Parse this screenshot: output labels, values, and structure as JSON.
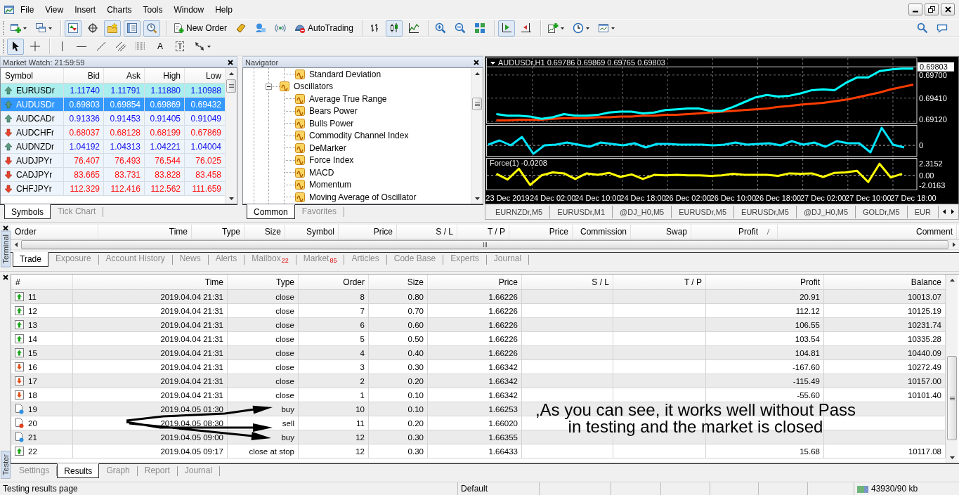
{
  "menu": {
    "items": [
      "File",
      "View",
      "Insert",
      "Charts",
      "Tools",
      "Window",
      "Help"
    ]
  },
  "toolbars": [
    {
      "groups": [
        [
          {
            "pressed": false
          },
          {
            "pressed": false
          }
        ],
        [
          {
            "pressed": true
          },
          {
            "pressed": false
          },
          {
            "pressed": true
          },
          {
            "pressed": true
          },
          {
            "pressed": true
          }
        ],
        [
          {
            "label": "New Order",
            "pressed": false
          },
          {
            "pressed": false
          },
          {
            "pressed": false
          },
          {
            "pressed": false
          },
          {
            "label": "AutoTrading",
            "pressed": false
          }
        ],
        [
          {
            "pressed": false
          },
          {
            "pressed": true
          },
          {
            "pressed": false
          }
        ],
        [
          {
            "pressed": false
          },
          {
            "pressed": false
          },
          {
            "pressed": false
          }
        ],
        [
          {
            "pressed": true
          },
          {
            "pressed": false
          }
        ],
        [
          {
            "pressed": false
          },
          {
            "pressed": false
          },
          {
            "pressed": false
          }
        ]
      ]
    },
    {
      "groups": [
        [
          {
            "pressed": true
          },
          {
            "pressed": false
          }
        ],
        [
          {
            "pressed": false
          },
          {
            "pressed": false
          },
          {
            "pressed": false
          },
          {
            "pressed": false
          },
          {
            "pressed": false
          },
          {
            "label": "A",
            "pressed": false
          },
          {
            "label": "T",
            "pressed": false
          },
          {
            "pressed": false
          }
        ]
      ]
    }
  ],
  "market_watch": {
    "title": "Market Watch: 21:59:59",
    "columns": [
      "Symbol",
      "Bid",
      "Ask",
      "High",
      "Low"
    ],
    "rows": [
      {
        "symbol": "EURUSDr",
        "bid": "1.11740",
        "ask": "1.11791",
        "high": "1.11880",
        "low": "1.10988",
        "rising": true,
        "highlighted": true,
        "selected": false
      },
      {
        "symbol": "AUDUSDr",
        "bid": "0.69803",
        "ask": "0.69854",
        "high": "0.69869",
        "low": "0.69432",
        "rising": true,
        "highlighted": false,
        "selected": true
      },
      {
        "symbol": "AUDCADr",
        "bid": "0.91336",
        "ask": "0.91453",
        "high": "0.91405",
        "low": "0.91049",
        "rising": true,
        "highlighted": false,
        "selected": false
      },
      {
        "symbol": "AUDCHFr",
        "bid": "0.68037",
        "ask": "0.68128",
        "high": "0.68199",
        "low": "0.67869",
        "rising": false,
        "highlighted": false,
        "selected": false
      },
      {
        "symbol": "AUDNZDr",
        "bid": "1.04192",
        "ask": "1.04313",
        "high": "1.04221",
        "low": "1.04004",
        "rising": true,
        "highlighted": false,
        "selected": false
      },
      {
        "symbol": "AUDJPYr",
        "bid": "76.407",
        "ask": "76.493",
        "high": "76.544",
        "low": "76.025",
        "rising": false,
        "highlighted": false,
        "selected": false
      },
      {
        "symbol": "CADJPYr",
        "bid": "83.665",
        "ask": "83.731",
        "high": "83.828",
        "low": "83.458",
        "rising": false,
        "highlighted": false,
        "selected": false
      },
      {
        "symbol": "CHFJPYr",
        "bid": "112.329",
        "ask": "112.416",
        "high": "112.562",
        "low": "111.659",
        "rising": false,
        "highlighted": false,
        "selected": false
      }
    ],
    "tabs": [
      {
        "label": "Symbols",
        "selected": true
      },
      {
        "label": "Tick Chart",
        "selected": false
      }
    ]
  },
  "navigator": {
    "title": "Navigator",
    "tree": [
      {
        "children": [
          {
            "label": "Standard Deviation"
          }
        ]
      },
      {
        "label": "Oscillators",
        "expanded": true,
        "children": [
          {
            "label": "Average True Range"
          },
          {
            "label": "Bears Power"
          },
          {
            "label": "Bulls Power"
          },
          {
            "label": "Commodity Channel Index"
          },
          {
            "label": "DeMarker"
          },
          {
            "label": "Force Index"
          },
          {
            "label": "MACD"
          },
          {
            "label": "Momentum"
          },
          {
            "label": "Moving Average of Oscillator"
          }
        ]
      }
    ],
    "tabs": [
      {
        "label": "Common",
        "selected": true
      },
      {
        "label": "Favorites",
        "selected": false
      }
    ]
  },
  "chart": {
    "chart_data": [
      {
        "type": "line",
        "title": "AUDUSDr,H1 0.69786 0.69869 0.69765 0.69803",
        "categories": [
          null,
          null,
          null,
          null,
          null,
          null,
          null,
          null,
          null,
          null,
          null,
          null,
          null,
          null,
          null,
          null,
          null,
          null,
          null,
          null,
          null,
          null,
          null,
          null,
          null,
          null,
          null,
          null,
          null,
          null,
          null,
          null,
          null,
          null,
          null,
          null,
          null,
          null
        ],
        "tick_labels": "y",
        "ylim": [
          0.691,
          0.6991
        ],
        "yticks": [
          {
            "value": 0.697,
            "label": "0.69700"
          },
          {
            "value": 0.6941,
            "label": "0.69410"
          },
          {
            "value": 0.6912,
            "label": "0.69120"
          }
        ],
        "grid": true,
        "ref_lines": [
          {
            "axis": "y",
            "value": 0.69803,
            "label": "0.69803",
            "color": "#c0c0c0"
          }
        ],
        "series": [
          {
            "color": "#00ffff",
            "values": [
              0.6921,
              0.6919,
              0.6919,
              0.6918,
              0.6915,
              0.6917,
              0.6921,
              0.6919,
              0.6919,
              0.692,
              0.6923,
              0.6924,
              0.6924,
              0.6922,
              0.6923,
              0.6926,
              0.6927,
              0.6928,
              0.6928,
              0.6925,
              0.6925,
              0.693,
              0.6936,
              0.6942,
              0.6945,
              0.6943,
              0.6944,
              0.6947,
              0.6951,
              0.6952,
              0.6951,
              0.696,
              0.6967,
              0.6967,
              0.6975,
              0.6977,
              0.6978,
              0.6978
            ]
          },
          {
            "color": "#ff3c00",
            "values": [
              0.6913,
              0.6913,
              0.6914,
              0.6914,
              0.6914,
              0.6915,
              0.6916,
              0.6916,
              0.6916,
              0.6917,
              0.6917,
              0.6918,
              0.6918,
              0.6919,
              0.6919,
              0.692,
              0.692,
              0.6921,
              0.6922,
              0.6923,
              0.6924,
              0.6925,
              0.6926,
              0.6927,
              0.6928,
              0.693,
              0.6931,
              0.6933,
              0.6934,
              0.6935,
              0.6937,
              0.6939,
              0.6942,
              0.6945,
              0.6948,
              0.6952,
              0.6955,
              0.6958
            ]
          }
        ]
      },
      {
        "type": "line",
        "title": "Force(1) -0.0208",
        "categories": [
          null,
          "23 Dec 2019",
          null,
          null,
          null,
          "24 Dec 02:00",
          null,
          null,
          null,
          "24 Dec 10:00",
          null,
          null,
          null,
          "24 Dec 18:00",
          null,
          null,
          null,
          "26 Dec 02:00",
          null,
          null,
          null,
          "26 Dec 10:00",
          null,
          null,
          null,
          "26 Dec 18:00",
          null,
          null,
          null,
          "27 Dec 02:00",
          null,
          null,
          null,
          "27 Dec 10:00",
          null,
          null,
          null,
          "27 Dec 18:00"
        ],
        "ylim": [
          -2.8,
          3.3
        ],
        "yticks": [
          {
            "value": 2.3152,
            "label": "2.3152"
          },
          {
            "value": 0,
            "label": "0.00"
          },
          {
            "value": -2.0163,
            "label": "-2.0163"
          }
        ],
        "grid": "x",
        "ref_lines": [
          {
            "axis": "y",
            "value": 0,
            "color": "#c0c0c0",
            "line_style": "dashed"
          }
        ],
        "series": [
          {
            "color": "#ffff00",
            "values": [
              0.3,
              -0.8,
              1.3,
              -1.9,
              0,
              0.6,
              0.4,
              -0.7,
              0.4,
              0.1,
              0.5,
              -0.3,
              0.2,
              -0.7,
              0.1,
              0,
              0.1,
              0,
              0,
              -0.1,
              0,
              0.3,
              0.1,
              0.1,
              0.1,
              -0.1,
              0.4,
              0.3,
              0.4,
              -0.3,
              0.5,
              0.6,
              0.9,
              -1.3,
              2.3,
              -0.4,
              0.3,
              null
            ]
          }
        ]
      }
    ],
    "indicator_pane": {
      "scale_label": "0"
    },
    "tabs": [
      {
        "label": "EURNZDr,M5",
        "selected": false
      },
      {
        "label": "EURUSDr,M1",
        "selected": false
      },
      {
        "label": "@DJ_H0,M5",
        "selected": false
      },
      {
        "label": "EURUSDr,M5",
        "selected": false
      },
      {
        "label": "EURUSDr,M5",
        "selected": false
      },
      {
        "label": "@DJ_H0,M5",
        "selected": false
      },
      {
        "label": "GOLDr,M5",
        "selected": false
      },
      {
        "label": "EUR",
        "selected": false
      }
    ]
  },
  "terminal": {
    "title": "Terminal",
    "columns": [
      {
        "label": "Order",
        "sorted": false
      },
      {
        "label": "Time",
        "sorted": false
      },
      {
        "label": "Type",
        "sorted": false
      },
      {
        "label": "Size",
        "sorted": false
      },
      {
        "label": "Symbol",
        "sorted": false
      },
      {
        "label": "Price",
        "sorted": false
      },
      {
        "label": "S / L",
        "sorted": false
      },
      {
        "label": "T / P",
        "sorted": false
      },
      {
        "label": "Price",
        "sorted": false
      },
      {
        "label": "Commission",
        "sorted": false
      },
      {
        "label": "Swap",
        "sorted": false
      },
      {
        "label": "Profit",
        "sorted": true
      },
      {
        "label": "Comment",
        "sorted": false
      }
    ],
    "tabs": [
      {
        "label": "Trade",
        "selected": true
      },
      {
        "label": "Exposure",
        "selected": false
      },
      {
        "label": "Account History",
        "selected": false
      },
      {
        "label": "News",
        "selected": false
      },
      {
        "label": "Alerts",
        "selected": false
      },
      {
        "label": "Mailbox",
        "badge": "22",
        "selected": false
      },
      {
        "label": "Market",
        "badge": "85",
        "selected": false
      },
      {
        "label": "Articles",
        "selected": false
      },
      {
        "label": "Code Base",
        "selected": false
      },
      {
        "label": "Experts",
        "selected": false
      },
      {
        "label": "Journal",
        "selected": false
      }
    ]
  },
  "tester": {
    "title": "Tester",
    "columns": [
      "#",
      "Time",
      "Type",
      "Order",
      "Size",
      "Price",
      "S / L",
      "T / P",
      "Profit",
      "Balance"
    ],
    "rows": [
      {
        "number": "11",
        "time": "2019.04.04 21:31",
        "type": "close",
        "order": "8",
        "size": "0.80",
        "price": "1.66226",
        "profit": "20.91",
        "balance": "10013.07",
        "kind": "profit"
      },
      {
        "number": "12",
        "time": "2019.04.04 21:31",
        "type": "close",
        "order": "7",
        "size": "0.70",
        "price": "1.66226",
        "profit": "112.12",
        "balance": "10125.19",
        "kind": "profit"
      },
      {
        "number": "13",
        "time": "2019.04.04 21:31",
        "type": "close",
        "order": "6",
        "size": "0.60",
        "price": "1.66226",
        "profit": "106.55",
        "balance": "10231.74",
        "kind": "profit"
      },
      {
        "number": "14",
        "time": "2019.04.04 21:31",
        "type": "close",
        "order": "5",
        "size": "0.50",
        "price": "1.66226",
        "profit": "103.54",
        "balance": "10335.28",
        "kind": "profit"
      },
      {
        "number": "15",
        "time": "2019.04.04 21:31",
        "type": "close",
        "order": "4",
        "size": "0.40",
        "price": "1.66226",
        "profit": "104.81",
        "balance": "10440.09",
        "kind": "profit"
      },
      {
        "number": "16",
        "time": "2019.04.04 21:31",
        "type": "close",
        "order": "3",
        "size": "0.30",
        "price": "1.66342",
        "profit": "-167.60",
        "balance": "10272.49",
        "kind": "loss"
      },
      {
        "number": "17",
        "time": "2019.04.04 21:31",
        "type": "close",
        "order": "2",
        "size": "0.20",
        "price": "1.66342",
        "profit": "-115.49",
        "balance": "10157.00",
        "kind": "loss"
      },
      {
        "number": "18",
        "time": "2019.04.04 21:31",
        "type": "close",
        "order": "1",
        "size": "0.10",
        "price": "1.66342",
        "profit": "-55.60",
        "balance": "10101.40",
        "kind": "loss"
      },
      {
        "number": "19",
        "time": "2019.04.05 01:30",
        "type": "buy",
        "order": "10",
        "size": "0.10",
        "price": "1.66253",
        "kind": "buy"
      },
      {
        "number": "20",
        "time": "2019.04.05 08:30",
        "type": "sell",
        "order": "11",
        "size": "0.20",
        "price": "1.66020",
        "kind": "sell"
      },
      {
        "number": "21",
        "time": "2019.04.05 09:00",
        "type": "buy",
        "order": "12",
        "size": "0.30",
        "price": "1.66355",
        "kind": "buy"
      },
      {
        "number": "22",
        "time": "2019.04.05 09:17",
        "type": "close at stop",
        "order": "12",
        "size": "0.30",
        "price": "1.66433",
        "profit": "15.68",
        "balance": "10117.08",
        "kind": "profit"
      }
    ],
    "tabs": [
      {
        "label": "Settings",
        "selected": false
      },
      {
        "label": "Results",
        "selected": true
      },
      {
        "label": "Graph",
        "selected": false
      },
      {
        "label": "Report",
        "selected": false
      },
      {
        "label": "Journal",
        "selected": false
      }
    ]
  },
  "annotation": {
    "lines": [
      ",As you can see, it works well without Pass",
      "in testing and the market is closed"
    ]
  },
  "status_bar": {
    "message": "Testing results page",
    "profile": "Default",
    "memory": "43930/90 kb"
  }
}
